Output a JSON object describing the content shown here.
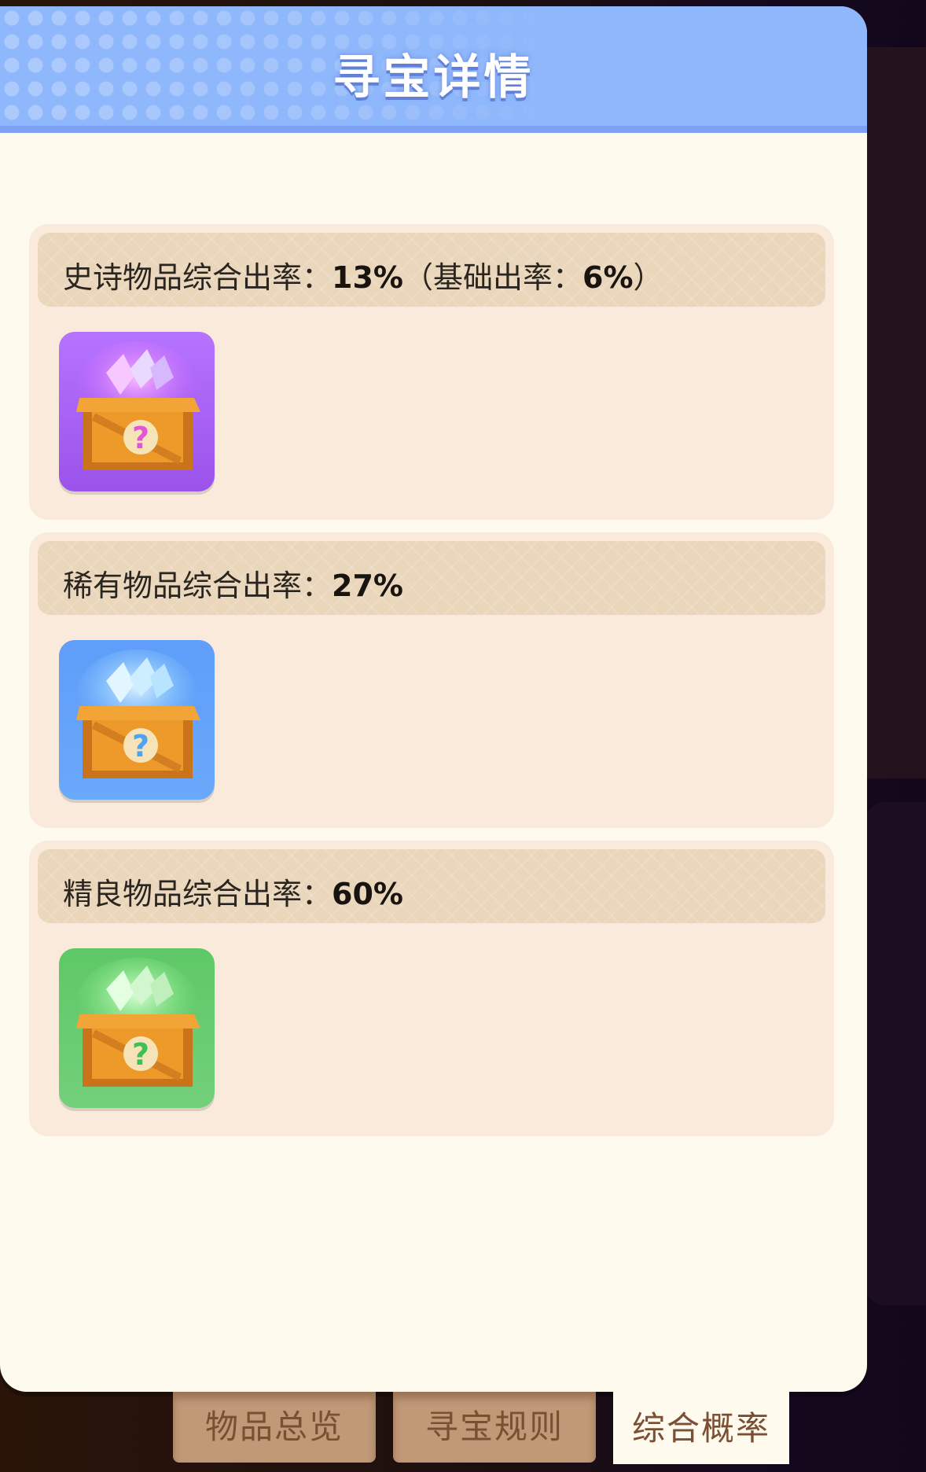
{
  "panel": {
    "title": "寻宝详情"
  },
  "sections": [
    {
      "rarity": "epic",
      "label": "史诗物品综合出率：",
      "rate": "13%",
      "extra_open": "（基础出率：",
      "base_rate": "6%",
      "extra_close": "）",
      "item_icon": "purple-mystery-crate-icon",
      "color": "#a45cf0"
    },
    {
      "rarity": "rare",
      "label": "稀有物品综合出率：",
      "rate": "27%",
      "item_icon": "blue-mystery-crate-icon",
      "color": "#5aa0f7"
    },
    {
      "rarity": "fine",
      "label": "精良物品综合出率：",
      "rate": "60%",
      "item_icon": "green-mystery-crate-icon",
      "color": "#67cc6a"
    }
  ],
  "tabs": [
    {
      "label": "物品总览",
      "active": false
    },
    {
      "label": "寻宝规则",
      "active": false
    },
    {
      "label": "综合概率",
      "active": true
    }
  ]
}
